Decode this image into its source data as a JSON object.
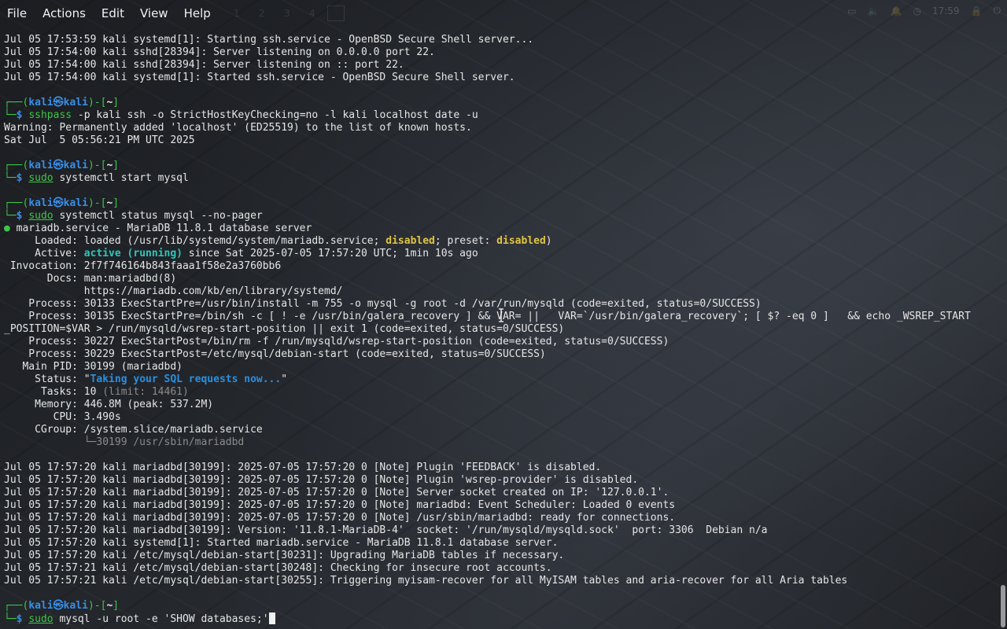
{
  "menubar": {
    "items": [
      "File",
      "Actions",
      "Edit",
      "View",
      "Help"
    ]
  },
  "workspaces": [
    "1",
    "2",
    "3",
    "4"
  ],
  "tray": {
    "clock": "17:59"
  },
  "colors": {
    "background": "#1e2024",
    "prompt_green": "#3ec54a",
    "prompt_blue": "#3a8ee6",
    "text": "#e6e6e6"
  },
  "terminal": {
    "prompt": {
      "user": "kali",
      "host": "kali",
      "dir": "~"
    },
    "log1": [
      "Jul 05 17:53:59 kali systemd[1]: Starting ssh.service - OpenBSD Secure Shell server...",
      "Jul 05 17:54:00 kali sshd[28394]: Server listening on 0.0.0.0 port 22.",
      "Jul 05 17:54:00 kali sshd[28394]: Server listening on :: port 22.",
      "Jul 05 17:54:00 kali systemd[1]: Started ssh.service - OpenBSD Secure Shell server."
    ],
    "cmd1": {
      "program": "sshpass",
      "args": " -p kali ssh -o StrictHostKeyChecking=no -l kali localhost date -u"
    },
    "out1": [
      "Warning: Permanently added 'localhost' (ED25519) to the list of known hosts.",
      "Sat Jul  5 05:56:21 PM UTC 2025"
    ],
    "cmd2": {
      "program": "sudo",
      "args": " systemctl start mysql"
    },
    "cmd3": {
      "program": "sudo",
      "args": " systemctl status mysql --no-pager"
    },
    "status": {
      "unit": "mariadb.service - MariaDB 11.8.1 database server",
      "loaded_pre": "     Loaded: loaded (/usr/lib/systemd/system/mariadb.service; ",
      "loaded_disabled": "disabled",
      "loaded_mid": "; preset: ",
      "loaded_preset": "disabled",
      "loaded_end": ")",
      "active_pre": "     Active: ",
      "active_state": "active (running)",
      "active_end": " since Sat 2025-07-05 17:57:20 UTC; 1min 10s ago",
      "invocation": " Invocation: 2f7f746164b843faaa1f58e2a3760bb6",
      "docs1": "       Docs: man:mariadbd(8)",
      "docs2": "             https://mariadb.com/kb/en/library/systemd/",
      "proc1": "    Process: 30133 ExecStartPre=/usr/bin/install -m 755 -o mysql -g root -d /var/run/mysqld (code=exited, status=0/SUCCESS)",
      "proc2a": "    Process: 30135 ExecStartPre=/bin/sh -c [ ! -e /usr/bin/galera_recovery ] && VAR= ||   VAR=`/usr/bin/galera_recovery`; [ $? -eq 0 ]   && echo _WSREP_START",
      "proc2b": "_POSITION=$VAR > /run/mysqld/wsrep-start-position || exit 1 (code=exited, status=0/SUCCESS)",
      "proc3": "    Process: 30227 ExecStartPost=/bin/rm -f /run/mysqld/wsrep-start-position (code=exited, status=0/SUCCESS)",
      "proc4": "    Process: 30229 ExecStartPost=/etc/mysql/debian-start (code=exited, status=0/SUCCESS)",
      "mainpid": "   Main PID: 30199 (mariadbd)",
      "status_pre": "     Status: \"",
      "status_text": "Taking your SQL requests now...",
      "status_end": "\"",
      "tasks_pre": "      Tasks: 10 ",
      "tasks_limit": "(limit: 14461)",
      "memory": "     Memory: 446.8M (peak: 537.2M)",
      "cpu": "        CPU: 3.490s",
      "cgroup": "     CGroup: /system.slice/mariadb.service",
      "cgroup_child": "             └─30199 /usr/sbin/mariadbd"
    },
    "log2": [
      "Jul 05 17:57:20 kali mariadbd[30199]: 2025-07-05 17:57:20 0 [Note] Plugin 'FEEDBACK' is disabled.",
      "Jul 05 17:57:20 kali mariadbd[30199]: 2025-07-05 17:57:20 0 [Note] Plugin 'wsrep-provider' is disabled.",
      "Jul 05 17:57:20 kali mariadbd[30199]: 2025-07-05 17:57:20 0 [Note] Server socket created on IP: '127.0.0.1'.",
      "Jul 05 17:57:20 kali mariadbd[30199]: 2025-07-05 17:57:20 0 [Note] mariadbd: Event Scheduler: Loaded 0 events",
      "Jul 05 17:57:20 kali mariadbd[30199]: 2025-07-05 17:57:20 0 [Note] /usr/sbin/mariadbd: ready for connections.",
      "Jul 05 17:57:20 kali mariadbd[30199]: Version: '11.8.1-MariaDB-4'  socket: '/run/mysqld/mysqld.sock'  port: 3306  Debian n/a",
      "Jul 05 17:57:20 kali systemd[1]: Started mariadb.service - MariaDB 11.8.1 database server.",
      "Jul 05 17:57:20 kali /etc/mysql/debian-start[30231]: Upgrading MariaDB tables if necessary.",
      "Jul 05 17:57:21 kali /etc/mysql/debian-start[30248]: Checking for insecure root accounts.",
      "Jul 05 17:57:21 kali /etc/mysql/debian-start[30255]: Triggering myisam-recover for all MyISAM tables and aria-recover for all Aria tables"
    ],
    "cmd4": {
      "program": "sudo",
      "args": " mysql -u root -e 'SHOW databases;'"
    }
  }
}
